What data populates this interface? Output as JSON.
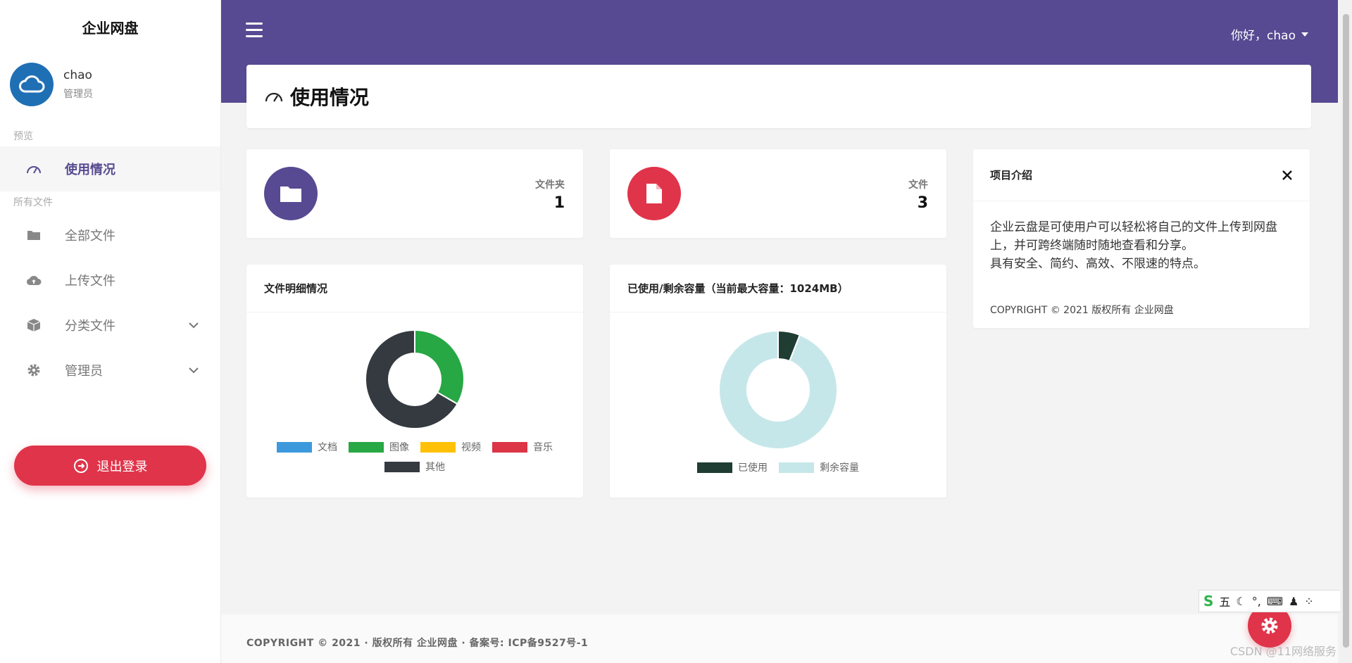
{
  "sidebar": {
    "brand": "企业网盘",
    "user": {
      "name": "chao",
      "role": "管理员"
    },
    "section_preview": "预览",
    "section_files": "所有文件",
    "items": [
      {
        "label": "使用情况",
        "icon": "gauge-icon"
      },
      {
        "label": "全部文件",
        "icon": "folder-icon"
      },
      {
        "label": "上传文件",
        "icon": "cloud-upload-icon"
      },
      {
        "label": "分类文件",
        "icon": "box-icon"
      },
      {
        "label": "管理员",
        "icon": "gear-icon"
      }
    ],
    "logout": "退出登录"
  },
  "header": {
    "greeting": "你好，chao"
  },
  "page": {
    "title": "使用情况"
  },
  "stats": {
    "folders": {
      "label": "文件夹",
      "value": "1"
    },
    "files": {
      "label": "文件",
      "value": "3"
    }
  },
  "charts_ui": {
    "file_detail_title": "文件明细情况",
    "capacity_title": "已使用/剩余容量（当前最大容量：1024MB）"
  },
  "chart_data": [
    {
      "type": "pie",
      "title": "文件明细情况",
      "categories": [
        "文档",
        "图像",
        "视频",
        "音乐",
        "其他"
      ],
      "values": [
        0,
        1,
        0,
        0,
        2
      ],
      "colors": [
        "#3c99dc",
        "#28a745",
        "#ffc107",
        "#dc3545",
        "#343a40"
      ]
    },
    {
      "type": "pie",
      "title": "已使用/剩余容量（当前最大容量：1024MB）",
      "categories": [
        "已使用",
        "剩余容量"
      ],
      "values": [
        6,
        94
      ],
      "colors": [
        "#1f3d33",
        "#c6e7e9"
      ]
    }
  ],
  "intro": {
    "title": "项目介绍",
    "body_line1": "企业云盘是可使用户可以轻松将自己的文件上传到网盘上，并可跨终端随时随地查看和分享。",
    "body_line2": "具有安全、简约、高效、不限速的特点。",
    "copyright": "COPYRIGHT © 2021 版权所有 企业网盘"
  },
  "footer": {
    "text": "COPYRIGHT © 2021 · 版权所有 企业网盘 · 备案号: ICP备9527号-1"
  },
  "ime": {
    "mode": "五"
  },
  "watermark": "CSDN @11网络服务",
  "colors": {
    "accent": "#574a92",
    "danger": "#e0344a"
  }
}
